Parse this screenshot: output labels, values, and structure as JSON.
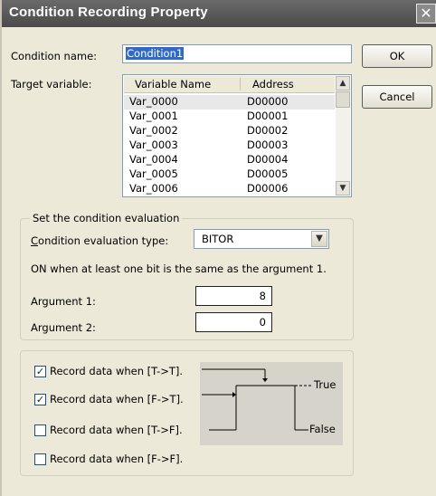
{
  "window": {
    "title": "Condition Recording Property",
    "close_glyph": "✕"
  },
  "condition_name": {
    "label": "Condition name:",
    "value": "Condition1"
  },
  "target_variable": {
    "label": "Target variable:",
    "columns": [
      "Variable Name",
      "Address"
    ],
    "rows": [
      {
        "name": "Var_0000",
        "address": "D00000"
      },
      {
        "name": "Var_0001",
        "address": "D00001"
      },
      {
        "name": "Var_0002",
        "address": "D00002"
      },
      {
        "name": "Var_0003",
        "address": "D00003"
      },
      {
        "name": "Var_0004",
        "address": "D00004"
      },
      {
        "name": "Var_0005",
        "address": "D00005"
      },
      {
        "name": "Var_0006",
        "address": "D00006"
      }
    ]
  },
  "buttons": {
    "ok": "OK",
    "cancel": "Cancel"
  },
  "evaluation": {
    "group_title": "Set the condition evaluation",
    "type_label_first": "C",
    "type_label_rest": "ondition evaluation type:",
    "type_value": "BITOR",
    "description": "ON when at least one bit is the same as the argument 1.",
    "argument1": {
      "label": "Argument 1:",
      "value": "8"
    },
    "argument2": {
      "label": "Argument 2:",
      "value": "0"
    }
  },
  "record": {
    "options": [
      {
        "label": "Record data when [T->T].",
        "checked": true
      },
      {
        "label": "Record data when [F->T].",
        "checked": true
      },
      {
        "label": "Record data when [T->F].",
        "checked": false
      },
      {
        "label": "Record data when [F->F].",
        "checked": false
      }
    ],
    "diagram": {
      "true_label": "True",
      "false_label": "False"
    }
  },
  "colors": {
    "dialog_bg": "#ece9d8",
    "titlebar": "#555555",
    "diagram_bg": "#d6d3ca"
  }
}
